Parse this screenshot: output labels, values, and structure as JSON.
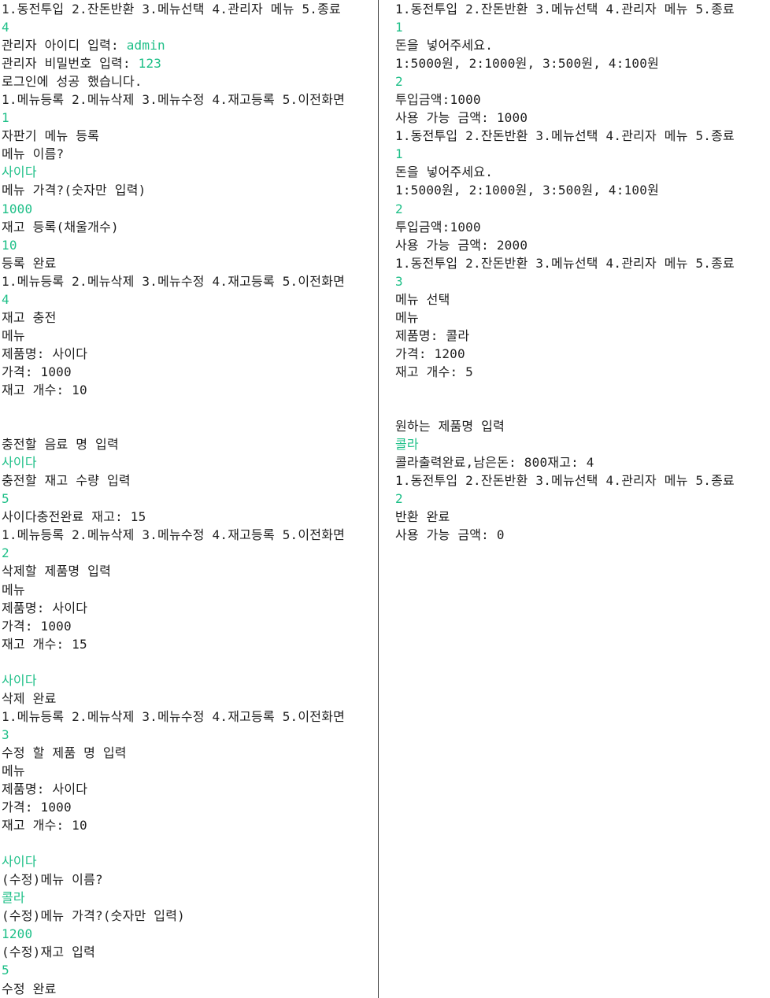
{
  "colors": {
    "output": "#1e1e1e",
    "input": "#1dbf87",
    "background": "#ffffff"
  },
  "left_console": [
    {
      "text": "1.동전투입 2.잔돈반환 3.메뉴선택 4.관리자 메뉴 5.종료",
      "kind": "output"
    },
    {
      "text": "4",
      "kind": "input"
    },
    {
      "text": "관리자 아이디 입력: ",
      "kind": "output",
      "input": "admin"
    },
    {
      "text": "관리자 비밀번호 입력: ",
      "kind": "output",
      "input": "123"
    },
    {
      "text": "로그인에 성공 했습니다.",
      "kind": "output"
    },
    {
      "text": "1.메뉴등록 2.메뉴삭제 3.메뉴수정 4.재고등록 5.이전화면",
      "kind": "output"
    },
    {
      "text": "1",
      "kind": "input"
    },
    {
      "text": "자판기 메뉴 등록",
      "kind": "output"
    },
    {
      "text": "메뉴 이름?",
      "kind": "output"
    },
    {
      "text": "사이다",
      "kind": "input"
    },
    {
      "text": "메뉴 가격?(숫자만 입력)",
      "kind": "output"
    },
    {
      "text": "1000",
      "kind": "input"
    },
    {
      "text": "재고 등록(채울개수)",
      "kind": "output"
    },
    {
      "text": "10",
      "kind": "input"
    },
    {
      "text": "등록 완료",
      "kind": "output"
    },
    {
      "text": "1.메뉴등록 2.메뉴삭제 3.메뉴수정 4.재고등록 5.이전화면",
      "kind": "output"
    },
    {
      "text": "4",
      "kind": "input"
    },
    {
      "text": "재고 충전",
      "kind": "output"
    },
    {
      "text": "메뉴",
      "kind": "output"
    },
    {
      "text": "제품명: 사이다",
      "kind": "output"
    },
    {
      "text": "가격: 1000",
      "kind": "output"
    },
    {
      "text": "재고 개수: 10",
      "kind": "output"
    },
    {
      "text": "",
      "kind": "blank"
    },
    {
      "text": "",
      "kind": "blank"
    },
    {
      "text": "충전할 음료 명 입력",
      "kind": "output"
    },
    {
      "text": "사이다",
      "kind": "input"
    },
    {
      "text": "충전할 재고 수량 입력",
      "kind": "output"
    },
    {
      "text": "5",
      "kind": "input"
    },
    {
      "text": "사이다충전완료 재고: 15",
      "kind": "output"
    },
    {
      "text": "1.메뉴등록 2.메뉴삭제 3.메뉴수정 4.재고등록 5.이전화면",
      "kind": "output"
    },
    {
      "text": "2",
      "kind": "input"
    },
    {
      "text": "삭제할 제품명 입력",
      "kind": "output"
    },
    {
      "text": "메뉴",
      "kind": "output"
    },
    {
      "text": "제품명: 사이다",
      "kind": "output"
    },
    {
      "text": "가격: 1000",
      "kind": "output"
    },
    {
      "text": "재고 개수: 15",
      "kind": "output"
    },
    {
      "text": "",
      "kind": "blank"
    },
    {
      "text": "사이다",
      "kind": "input"
    },
    {
      "text": "삭제 완료",
      "kind": "output"
    },
    {
      "text": "1.메뉴등록 2.메뉴삭제 3.메뉴수정 4.재고등록 5.이전화면",
      "kind": "output"
    },
    {
      "text": "3",
      "kind": "input"
    },
    {
      "text": "수정 할 제품 명 입력",
      "kind": "output"
    },
    {
      "text": "메뉴",
      "kind": "output"
    },
    {
      "text": "제품명: 사이다",
      "kind": "output"
    },
    {
      "text": "가격: 1000",
      "kind": "output"
    },
    {
      "text": "재고 개수: 10",
      "kind": "output"
    },
    {
      "text": "",
      "kind": "blank"
    },
    {
      "text": "사이다",
      "kind": "input"
    },
    {
      "text": "(수정)메뉴 이름?",
      "kind": "output"
    },
    {
      "text": "콜라",
      "kind": "input"
    },
    {
      "text": "(수정)메뉴 가격?(숫자만 입력)",
      "kind": "output"
    },
    {
      "text": "1200",
      "kind": "input"
    },
    {
      "text": "(수정)재고 입력",
      "kind": "output"
    },
    {
      "text": "5",
      "kind": "input"
    },
    {
      "text": "수정 완료",
      "kind": "output"
    }
  ],
  "right_console": [
    {
      "text": "1.동전투입 2.잔돈반환 3.메뉴선택 4.관리자 메뉴 5.종료",
      "kind": "output"
    },
    {
      "text": "1",
      "kind": "input"
    },
    {
      "text": "돈을 넣어주세요.",
      "kind": "output"
    },
    {
      "text": "1:5000원, 2:1000원, 3:500원, 4:100원",
      "kind": "output"
    },
    {
      "text": "2",
      "kind": "input"
    },
    {
      "text": "투입금액:1000",
      "kind": "output"
    },
    {
      "text": "사용 가능 금액: 1000",
      "kind": "output"
    },
    {
      "text": "1.동전투입 2.잔돈반환 3.메뉴선택 4.관리자 메뉴 5.종료",
      "kind": "output"
    },
    {
      "text": "1",
      "kind": "input"
    },
    {
      "text": "돈을 넣어주세요.",
      "kind": "output"
    },
    {
      "text": "1:5000원, 2:1000원, 3:500원, 4:100원",
      "kind": "output"
    },
    {
      "text": "2",
      "kind": "input"
    },
    {
      "text": "투입금액:1000",
      "kind": "output"
    },
    {
      "text": "사용 가능 금액: 2000",
      "kind": "output"
    },
    {
      "text": "1.동전투입 2.잔돈반환 3.메뉴선택 4.관리자 메뉴 5.종료",
      "kind": "output"
    },
    {
      "text": "3",
      "kind": "input"
    },
    {
      "text": "메뉴 선택",
      "kind": "output"
    },
    {
      "text": "메뉴",
      "kind": "output"
    },
    {
      "text": "제품명: 콜라",
      "kind": "output"
    },
    {
      "text": "가격: 1200",
      "kind": "output"
    },
    {
      "text": "재고 개수: 5",
      "kind": "output"
    },
    {
      "text": "",
      "kind": "blank"
    },
    {
      "text": "",
      "kind": "blank"
    },
    {
      "text": "원하는 제품명 입력",
      "kind": "output"
    },
    {
      "text": "콜라",
      "kind": "input"
    },
    {
      "text": "콜라출력완료,남은돈: 800재고: 4",
      "kind": "output"
    },
    {
      "text": "1.동전투입 2.잔돈반환 3.메뉴선택 4.관리자 메뉴 5.종료",
      "kind": "output"
    },
    {
      "text": "2",
      "kind": "input"
    },
    {
      "text": "반환 완료",
      "kind": "output"
    },
    {
      "text": "사용 가능 금액: 0",
      "kind": "output"
    }
  ]
}
